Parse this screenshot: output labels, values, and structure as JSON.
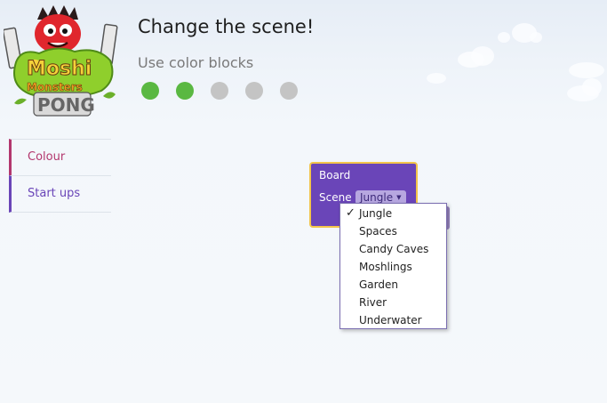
{
  "header": {
    "title": "Change the scene!",
    "subtitle": "Use color blocks"
  },
  "logo": {
    "text_line1": "Moshi",
    "text_line2": "Monsters",
    "text_line3": "PONG"
  },
  "progress": {
    "total": 5,
    "completed": 2,
    "colors": {
      "done": "#5ab842",
      "todo": "#c4c4c4"
    }
  },
  "sidebar": {
    "items": [
      {
        "label": "Colour",
        "color": "#b3376e"
      },
      {
        "label": "Start ups",
        "color": "#6a45b8"
      }
    ]
  },
  "block": {
    "title": "Board",
    "scene_label": "Scene",
    "scene_value": "Jungle"
  },
  "dropdown": {
    "check_mark": "✓",
    "selected": "Jungle",
    "options": [
      "Jungle",
      "Spaces",
      "Candy Caves",
      "Moshlings",
      "Garden",
      "River",
      "Underwater"
    ]
  }
}
